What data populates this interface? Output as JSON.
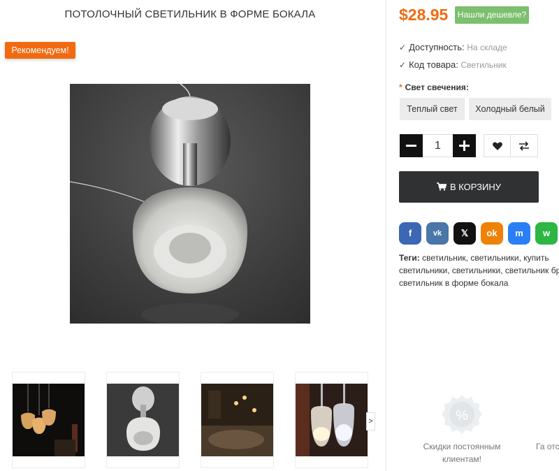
{
  "product": {
    "title": "ПОТОЛОЧНЫЙ СВЕТИЛЬНИК В ФОРМЕ БОКАЛА",
    "badge": "Рекомендуем!",
    "next_arrow": ">"
  },
  "pricing": {
    "price": "$28.95",
    "cheaper_label": "Нашли дешевле?"
  },
  "info": {
    "availability_label": "Доступность:",
    "availability_value": "На складе",
    "code_label": "Код товара:",
    "code_value": "Светильник"
  },
  "options": {
    "required_mark": "*",
    "label": "Свет свечения:",
    "values": [
      "Теплый свет",
      "Холодный белый"
    ]
  },
  "quantity": {
    "value": "1"
  },
  "cart": {
    "label": "В корзину"
  },
  "share": {
    "facebook": "f",
    "vk": "vk",
    "x": "𝕏",
    "ok": "ok",
    "messenger": "m",
    "whatsapp": "w"
  },
  "tags": {
    "label": "Теги:",
    "text": "светильник, светильники, купить светильники, светильники, светильник бра, светильник в форме бокала"
  },
  "features": {
    "discount_text": "Скидки постоянным клиентам!",
    "next_text": "Га отсле"
  },
  "colors": {
    "accent": "#f26a10",
    "green": "#7cbf6e",
    "dark_button": "#2f3133"
  },
  "icons": [
    "check-icon",
    "heart-icon",
    "compare-icon",
    "cart-icon",
    "percent-icon",
    "facebook-icon",
    "vk-icon",
    "x-icon",
    "odnoklassniki-icon",
    "messenger-icon",
    "whatsapp-icon"
  ]
}
